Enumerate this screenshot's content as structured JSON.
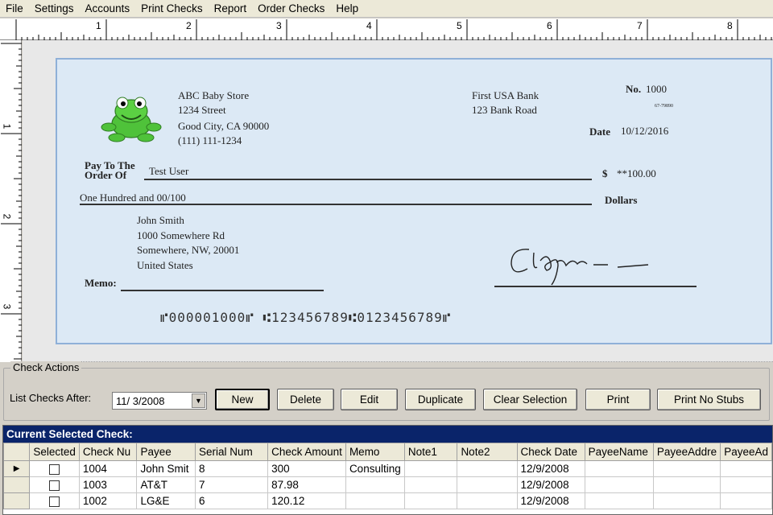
{
  "menu": [
    "File",
    "Settings",
    "Accounts",
    "Print Checks",
    "Report",
    "Order Checks",
    "Help"
  ],
  "ruler": {
    "h_numbers": [
      "1",
      "2",
      "3",
      "4",
      "5",
      "6",
      "7",
      "8"
    ],
    "v_numbers": [
      "1",
      "2",
      "3"
    ]
  },
  "check": {
    "company_name": "ABC Baby Store",
    "company_street": "1234 Street",
    "company_city": "Good City, CA 90000",
    "company_phone": "(111) 111-1234",
    "bank_name": "First USA Bank",
    "bank_address": "123 Bank Road",
    "no_label": "No.",
    "check_number": "1000",
    "routing_fraction": "67-79890",
    "date_label": "Date",
    "date": "10/12/2016",
    "pay_to_label_1": "Pay To The",
    "pay_to_label_2": "Order Of",
    "payee": "Test User",
    "dollar_sign": "$",
    "amount": "**100.00",
    "amount_words": "One Hundred  and 00/100",
    "dollars_label": "Dollars",
    "address_name": "John Smith",
    "address_street": "1000 Somewhere Rd",
    "address_city": "Somewhere, NW, 20001",
    "address_country": "United States",
    "memo_label": "Memo:",
    "micr": "⑈000001000⑈ ⑆123456789⑆0123456789⑈"
  },
  "actions": {
    "legend": "Check Actions",
    "list_label": "List Checks After:",
    "list_date": "11/ 3/2008",
    "buttons": [
      "New",
      "Delete",
      "Edit",
      "Duplicate",
      "Clear Selection",
      "Print",
      "Print No Stubs"
    ]
  },
  "grid": {
    "title": "Current Selected Check:",
    "columns": [
      "Selected",
      "Check Nu",
      "Payee",
      "Serial Num",
      "Check Amount",
      "Memo",
      "Note1",
      "Note2",
      "Check Date",
      "PayeeName",
      "PayeeAddre",
      "PayeeAd"
    ],
    "rows": [
      {
        "check_no": "1004",
        "payee": "John Smit",
        "serial": "8",
        "amount": "300",
        "memo": "Consulting",
        "note1": "",
        "note2": "",
        "date": "12/9/2008"
      },
      {
        "check_no": "1003",
        "payee": "AT&T",
        "serial": "7",
        "amount": "87.98",
        "memo": "",
        "note1": "",
        "note2": "",
        "date": "12/9/2008"
      },
      {
        "check_no": "1002",
        "payee": "LG&E",
        "serial": "6",
        "amount": "120.12",
        "memo": "",
        "note1": "",
        "note2": "",
        "date": "12/9/2008"
      }
    ]
  }
}
